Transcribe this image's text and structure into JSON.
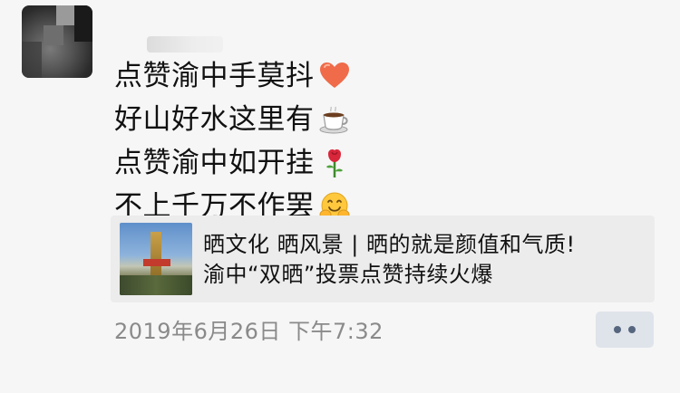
{
  "post": {
    "lines": [
      {
        "text": "点赞渝中手莫抖",
        "emoji": "heart-emoji"
      },
      {
        "text": "好山好水这里有",
        "emoji": "coffee-emoji"
      },
      {
        "text": "点赞渝中如开挂",
        "emoji": "rose-emoji"
      },
      {
        "text": "不上千万不作罢",
        "emoji": "hugging-face-emoji"
      }
    ]
  },
  "link_card": {
    "title_line1": "晒文化 晒风景 | 晒的就是颜值和气质!",
    "title_line2": "渝中“双晒”投票点赞持续火爆"
  },
  "meta": {
    "timestamp": "2019年6月26日 下午7:32"
  },
  "colors": {
    "background": "#f6f6f6",
    "card_background": "#ececec",
    "timestamp_text": "#8a8a8a",
    "more_button_bg": "#dfe3ea",
    "more_button_dot": "#56667e"
  },
  "icons": [
    "heart-emoji",
    "coffee-emoji",
    "rose-emoji",
    "hugging-face-emoji",
    "more-dots-icon"
  ]
}
